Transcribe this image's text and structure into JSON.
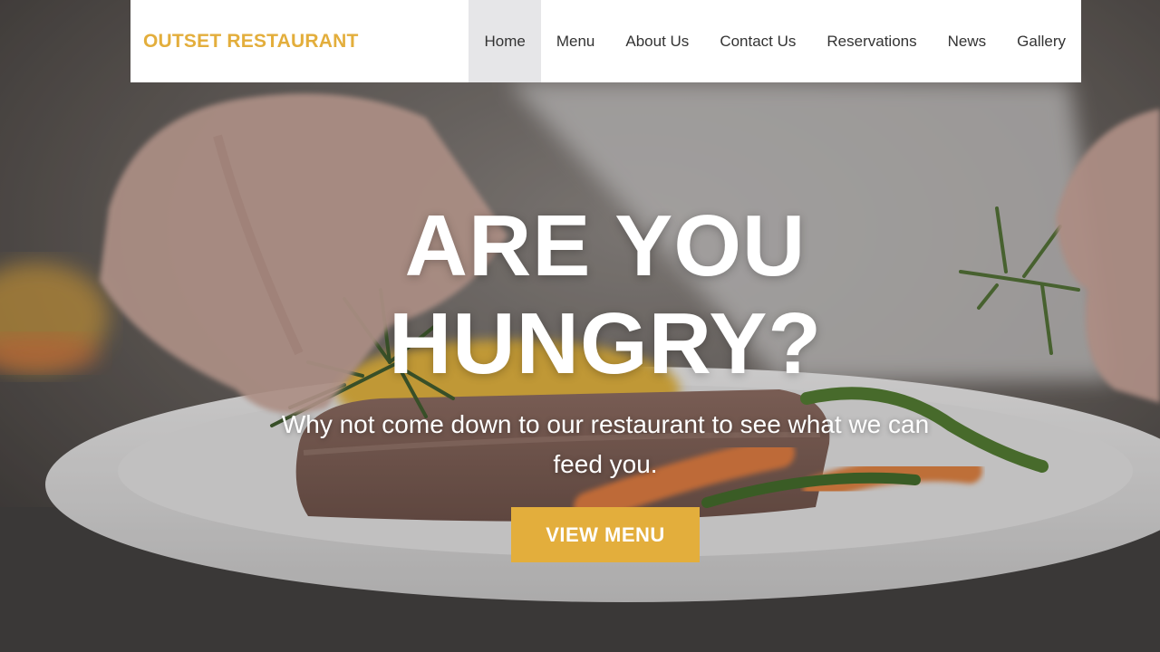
{
  "brand": {
    "name": "OUTSET RESTAURANT",
    "color": "#e3ae3c"
  },
  "nav": {
    "items": [
      {
        "label": "Home",
        "active": true
      },
      {
        "label": "Menu",
        "active": false
      },
      {
        "label": "About Us",
        "active": false
      },
      {
        "label": "Contact Us",
        "active": false
      },
      {
        "label": "Reservations",
        "active": false
      },
      {
        "label": "News",
        "active": false
      },
      {
        "label": "Gallery",
        "active": false
      }
    ]
  },
  "hero": {
    "title_line1": "ARE YOU",
    "title_line2": "HUNGRY?",
    "subtitle": "Why not come down to our restaurant to see what we can feed you.",
    "cta_label": "VIEW MENU",
    "cta_color": "#e3ae3c",
    "background_image": "chef-plating-steak-with-rosemary-and-vegetables"
  }
}
